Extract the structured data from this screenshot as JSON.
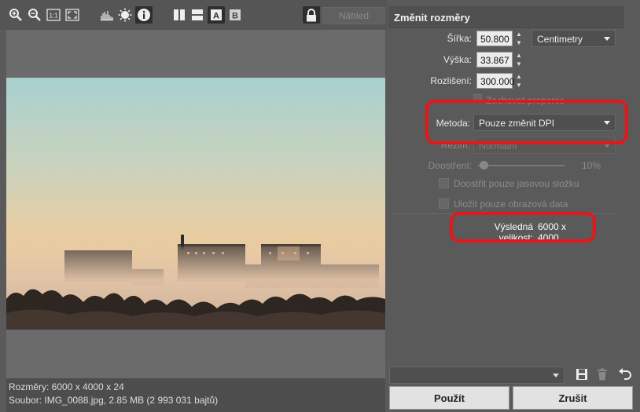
{
  "toolbar": {
    "icons": [
      "zoom-in-icon",
      "zoom-out-icon",
      "actual-size-icon",
      "fit-screen-icon",
      "histogram-icon",
      "brightness-icon",
      "info-icon",
      "split-vertical-icon",
      "split-horizontal-icon",
      "view-a-icon",
      "view-b-icon",
      "lock-icon"
    ],
    "a_label": "A",
    "b_label": "B",
    "actual_label": "1:1",
    "preview_label": "Náhled"
  },
  "status": {
    "dimensions": "Rozměry: 6000 x 4000 x 24",
    "file": "Soubor: IMG_0088.jpg, 2.85 MB (2 993 031 bajtů)"
  },
  "panel": {
    "title": "Změnit rozměry",
    "width_label": "Šířka:",
    "width_value": "50.800",
    "unit": "Centimetry",
    "height_label": "Výška:",
    "height_value": "33.867",
    "resolution_label": "Rozlišení:",
    "resolution_value": "300.000",
    "keep_ratio_label": "Zachovat proporce",
    "method_label": "Metoda:",
    "method_value": "Pouze změnit DPI",
    "mode_label": "Režim:",
    "mode_value": "Normální",
    "sharpen_label": "Doostření:",
    "sharpen_value": "10%",
    "sharpen_luma_label": "Doostřit pouze jasovou složku",
    "save_data_label": "Uložit pouze obrazová data",
    "result_label": "Výsledná velikost:",
    "result_value": "6000 x 4000"
  },
  "footer": {
    "apply_label": "Použít",
    "cancel_label": "Zrušit"
  },
  "colors": {
    "highlight": "#e8161b",
    "panel_bg": "#5a5a5a",
    "input_bg": "#ececec"
  }
}
